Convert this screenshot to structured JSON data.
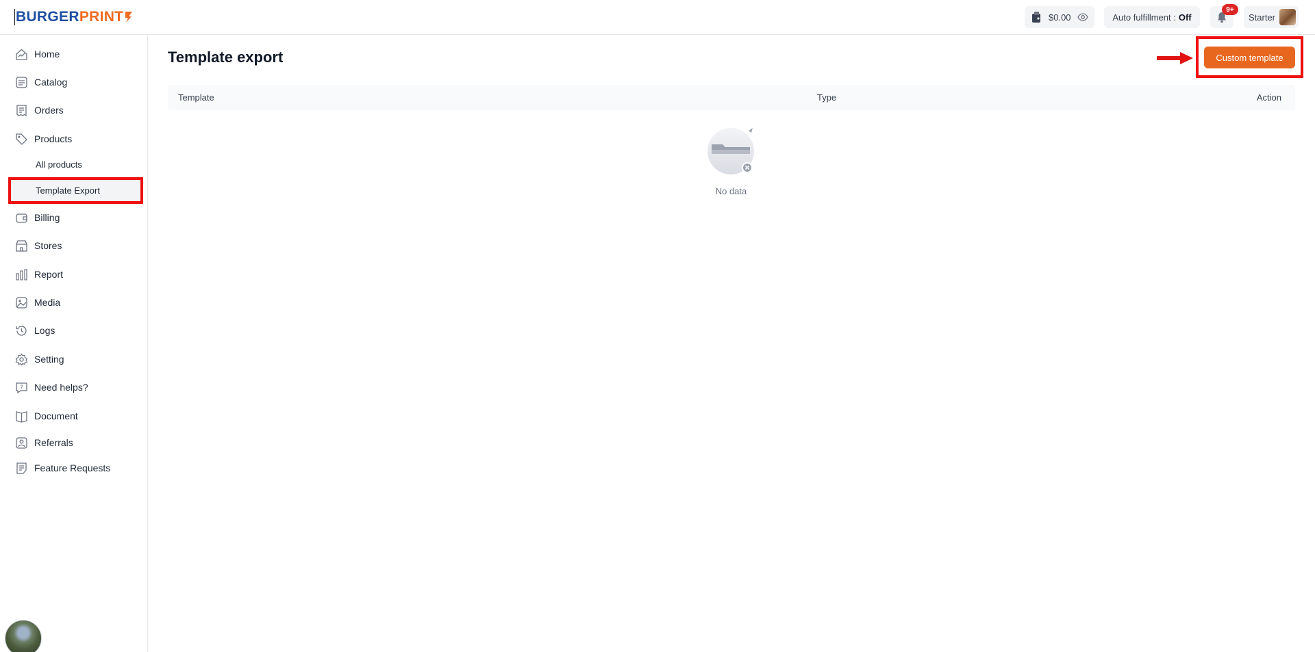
{
  "brand": {
    "part1": "BURGER",
    "part2": "PRINT"
  },
  "header": {
    "balance": "$0.00",
    "auto_fulfillment_label": "Auto fulfillment :",
    "auto_fulfillment_value": "Off",
    "notifications_badge": "9+",
    "plan": "Starter"
  },
  "sidebar": {
    "items": [
      {
        "label": "Home",
        "icon": "home-chart-icon"
      },
      {
        "label": "Catalog",
        "icon": "catalog-icon"
      },
      {
        "label": "Orders",
        "icon": "orders-icon"
      },
      {
        "label": "Products",
        "icon": "tag-icon"
      },
      {
        "label": "Billing",
        "icon": "wallet-icon"
      },
      {
        "label": "Stores",
        "icon": "store-icon"
      },
      {
        "label": "Report",
        "icon": "bar-chart-icon"
      },
      {
        "label": "Media",
        "icon": "image-icon"
      },
      {
        "label": "Logs",
        "icon": "history-icon"
      },
      {
        "label": "Setting",
        "icon": "gear-icon"
      },
      {
        "label": "Need helps?",
        "icon": "help-icon"
      },
      {
        "label": "Document",
        "icon": "book-icon"
      },
      {
        "label": "Referrals",
        "icon": "referral-icon"
      },
      {
        "label": "Feature Requests",
        "icon": "feature-request-icon"
      }
    ],
    "product_sub_items": [
      {
        "label": "All products"
      },
      {
        "label": "Template Export",
        "active": true
      }
    ]
  },
  "main": {
    "title": "Template export",
    "custom_button": "Custom template",
    "table": {
      "columns": [
        "Template",
        "Type",
        "Action"
      ],
      "empty_text": "No data"
    }
  },
  "colors": {
    "accent": "#e8671f",
    "brand_blue": "#1e4fa3",
    "brand_orange": "#ef6a22",
    "highlight_red": "#ef1010",
    "badge_red": "#dc2626"
  }
}
